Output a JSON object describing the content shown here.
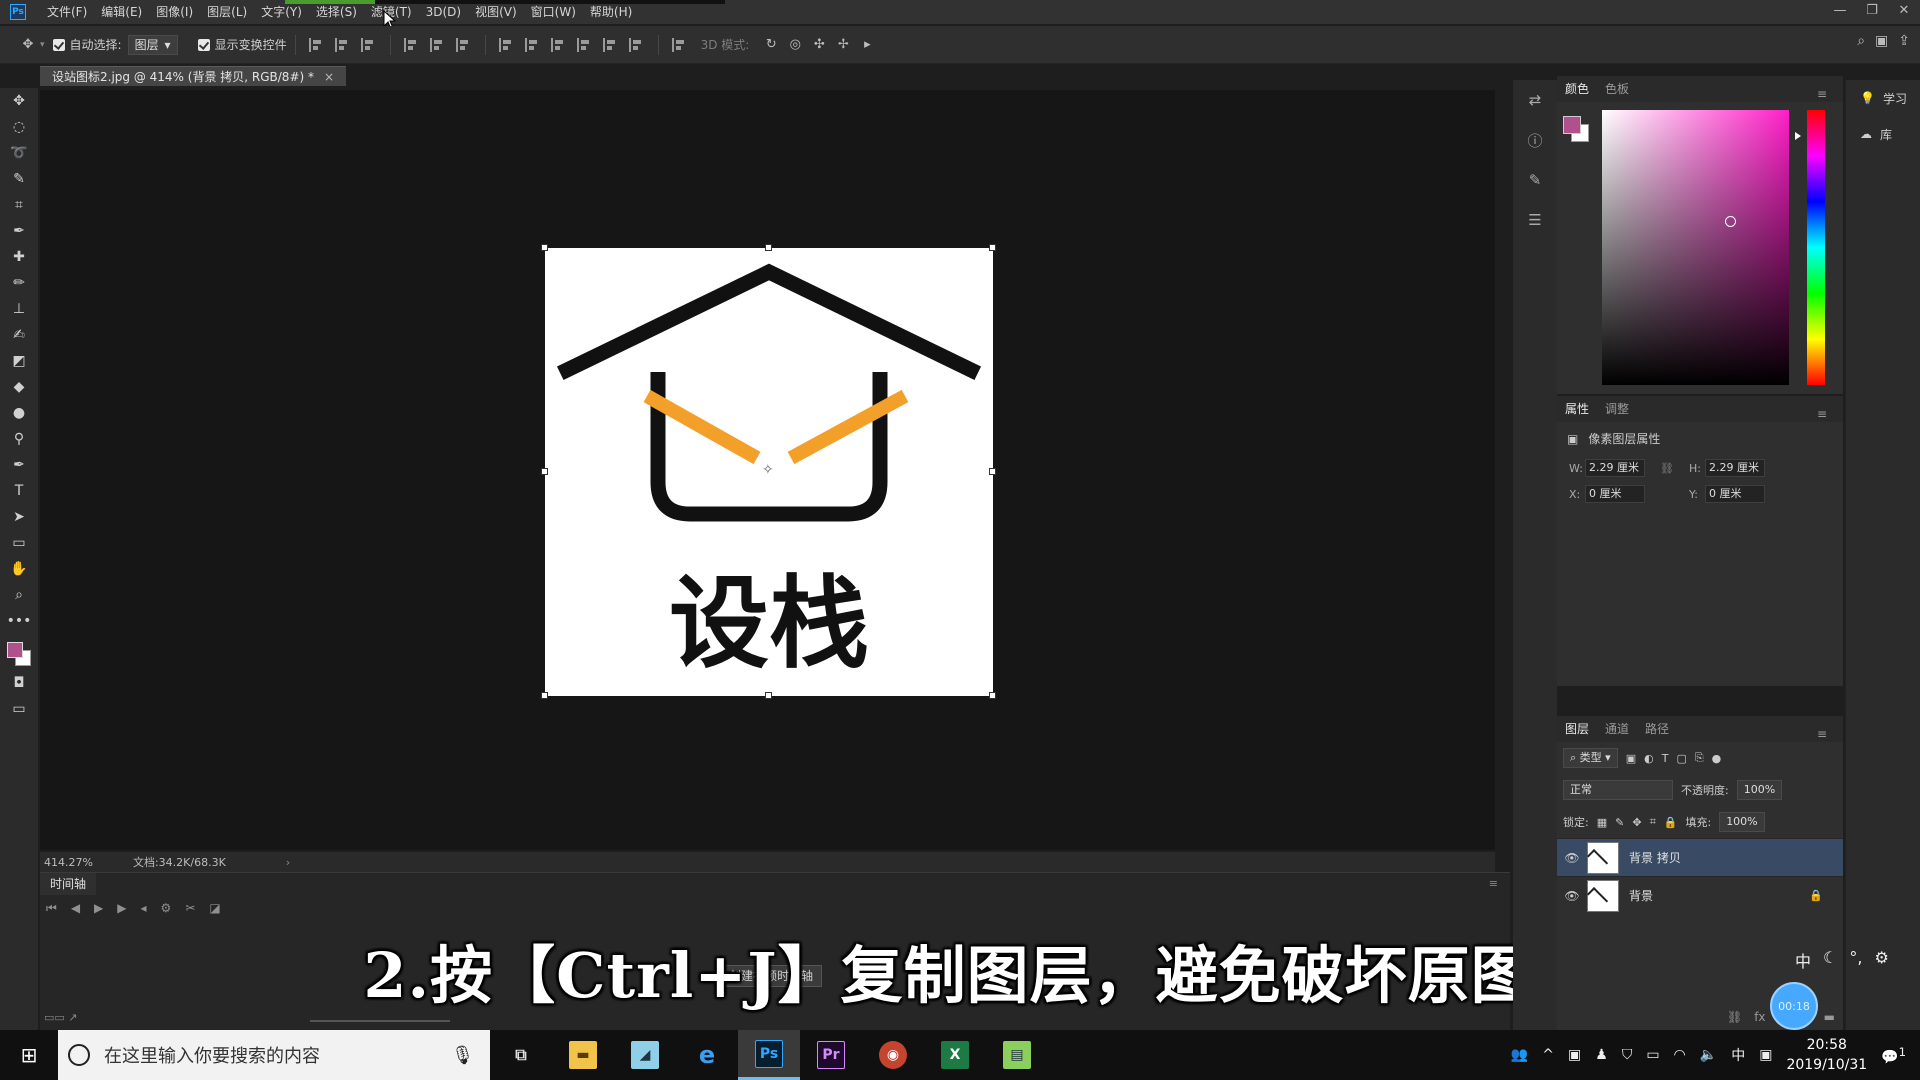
{
  "menubar": {
    "logo": "Ps",
    "items": [
      "文件(F)",
      "编辑(E)",
      "图像(I)",
      "图层(L)",
      "文字(Y)",
      "选择(S)",
      "滤镜(T)",
      "3D(D)",
      "视图(V)",
      "窗口(W)",
      "帮助(H)"
    ],
    "window_controls": [
      "—",
      "❐",
      "✕"
    ]
  },
  "options": {
    "auto_select_label": "自动选择:",
    "auto_select_value": "图层",
    "show_transform_label": "显示变换控件",
    "mode_3d_label": "3D 模式:"
  },
  "document": {
    "tab_title": "设站图标2.jpg @ 414% (背景 拷贝, RGB/8#) *",
    "zoom": "414.27%",
    "doc_size": "文档:34.2K/68.3K",
    "logo_text": "设栈"
  },
  "timeline": {
    "tab_label": "时间轴",
    "create_button": "创建视频时间轴"
  },
  "subtitle": "2.按【Ctrl+J】复制图层，避免破坏原图。",
  "learn": {
    "learn_label": "学习",
    "library_label": "库"
  },
  "color_panel": {
    "tabs": [
      "颜色",
      "色板"
    ],
    "fg_color": "#b0508c",
    "bg_color": "#ffffff"
  },
  "properties_panel": {
    "tabs": [
      "属性",
      "调整"
    ],
    "header": "像素图层属性",
    "w_label": "W:",
    "w_value": "2.29 厘米",
    "h_label": "H:",
    "h_value": "2.29 厘米",
    "x_label": "X:",
    "x_value": "0 厘米",
    "y_label": "Y:",
    "y_value": "0 厘米"
  },
  "layers_panel": {
    "tabs": [
      "图层",
      "通道",
      "路径"
    ],
    "filter_label": "类型",
    "blend_mode": "正常",
    "opacity_label": "不透明度:",
    "opacity_value": "100%",
    "lock_label": "锁定:",
    "fill_label": "填充:",
    "fill_value": "100%",
    "layers": [
      {
        "name": "背景 拷贝",
        "active": true
      },
      {
        "name": "背景",
        "active": false
      }
    ]
  },
  "ime": [
    "中",
    "☾",
    "°,",
    "⚙"
  ],
  "recording": "00:18",
  "taskbar": {
    "search_placeholder": "在这里输入你要搜索的内容",
    "apps": [
      "Ps",
      "Pr",
      "X"
    ],
    "tray_lang": "中",
    "time": "20:58",
    "date": "2019/10/31",
    "notification_count": "1"
  }
}
